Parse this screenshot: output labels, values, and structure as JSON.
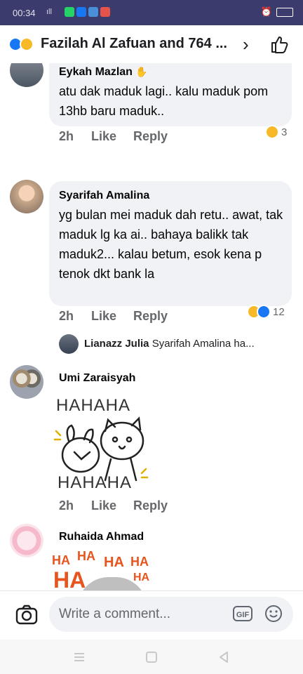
{
  "status_bar": {
    "time": "00:34",
    "signal": "ıll",
    "battery": "▮"
  },
  "header": {
    "title": "Fazilah Al Zafuan and 764 ...",
    "chevron": "›"
  },
  "comments": [
    {
      "name": "Eykah Mazlan",
      "name_badge": "✋",
      "text": "atu dak maduk lagi.. kalu maduk pom 13hb baru maduk..",
      "time": "2h",
      "like": "Like",
      "reply": "Reply",
      "reaction_count": "3"
    },
    {
      "name": "Syarifah Amalina",
      "text": "yg bulan mei maduk dah retu.. awat, tak maduk lg ka ai.. bahaya balikk tak maduk2... kalau betum, esok kena p tenok dkt bank la",
      "time": "2h",
      "like": "Like",
      "reply": "Reply",
      "reaction_count": "12"
    },
    {
      "reply_preview_name": "Lianazz Julia",
      "reply_preview_text": "Syarifah Amalina ha..."
    },
    {
      "name": "Umi Zaraisyah",
      "sticker_text_top": "HAHAHA",
      "sticker_text_bottom": "HAHAHA",
      "time": "2h",
      "like": "Like",
      "reply": "Reply"
    },
    {
      "name": "Ruhaida Ahmad",
      "sticker_words": [
        "HA",
        "HA",
        "HA",
        "HA",
        "HA",
        "HA",
        "HA"
      ]
    }
  ],
  "composer": {
    "placeholder": "Write a comment...",
    "gif_label": "GIF"
  },
  "colors": {
    "status_bar": "#3c3b6e",
    "bubble": "#f0f2f5",
    "meta": "#65676b",
    "like_blue": "#1877f2",
    "haha_yellow": "#f7b928"
  }
}
